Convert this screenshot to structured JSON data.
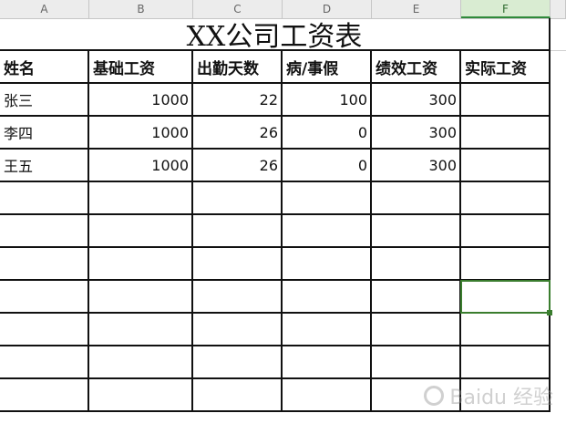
{
  "columns": [
    "A",
    "B",
    "C",
    "D",
    "E",
    "F"
  ],
  "selected_column": "F",
  "title": "XX公司工资表",
  "headers": [
    "姓名",
    "基础工资",
    "出勤天数",
    "病/事假",
    "绩效工资",
    "实际工资"
  ],
  "rows": [
    [
      "张三",
      "1000",
      "22",
      "100",
      "300",
      ""
    ],
    [
      "李四",
      "1000",
      "26",
      "0",
      "300",
      ""
    ],
    [
      "王五",
      "1000",
      "26",
      "0",
      "300",
      ""
    ]
  ],
  "empty_row_count": 7,
  "watermark": "Baidu 经验",
  "colors": {
    "selection": "#3a7d2e",
    "grid": "#111111"
  }
}
